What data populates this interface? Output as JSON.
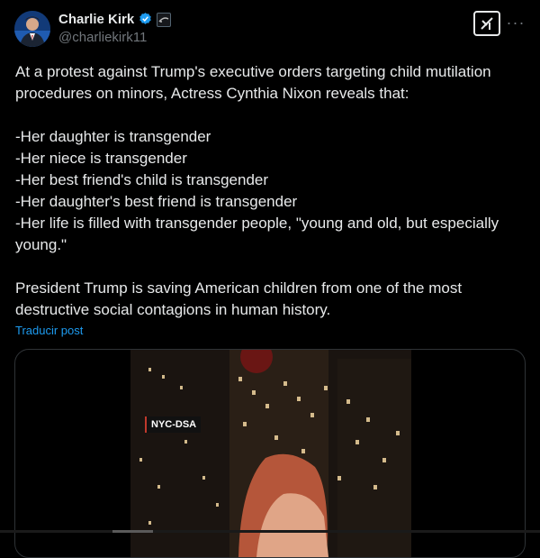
{
  "author": {
    "display_name": "Charlie Kirk",
    "handle": "@charliekirk11",
    "verified": true,
    "affiliation_icon": "affiliate-badge-icon"
  },
  "tweet": {
    "text": "At a protest against Trump's executive orders targeting child mutilation procedures on minors, Actress Cynthia Nixon reveals that:\n\n-Her daughter is transgender\n-Her niece is transgender\n-Her best friend's child is transgender\n-Her daughter's best friend is transgender\n-Her life is filled with transgender people, \"young and old, but especially young.\"\n\nPresident Trump is saving American children from one of the most destructive social contagions in human history.",
    "translate_label": "Traducir post"
  },
  "media": {
    "overlay_label": "NYC-DSA"
  },
  "colors": {
    "background": "#000000",
    "text": "#e7e9ea",
    "secondary": "#71767b",
    "accent": "#1d9bf0",
    "border": "#2f3336"
  }
}
